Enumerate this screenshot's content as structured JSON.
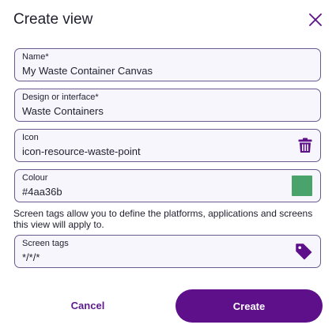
{
  "dialog": {
    "title": "Create view",
    "close_icon": "close-icon"
  },
  "fields": {
    "name": {
      "label": "Name*",
      "value": "My Waste Container Canvas"
    },
    "design": {
      "label": "Design or interface*",
      "value": "Waste Containers"
    },
    "icon": {
      "label": "Icon",
      "value": "icon-resource-waste-point",
      "trailing_icon": "trash-icon"
    },
    "colour": {
      "label": "Colour",
      "value": "#4aa36b",
      "swatch_color": "#4aa36b"
    },
    "screen_tags": {
      "label": "Screen tags",
      "value": "*/*/*",
      "trailing_icon": "tag-icon"
    }
  },
  "hint": "Screen tags allow you to define the platforms, applications and screens this view will apply to.",
  "actions": {
    "cancel_label": "Cancel",
    "create_label": "Create"
  },
  "colors": {
    "accent": "#5e0f8a",
    "field_border": "#6a5b8f",
    "field_bg": "#f7f6fc"
  }
}
